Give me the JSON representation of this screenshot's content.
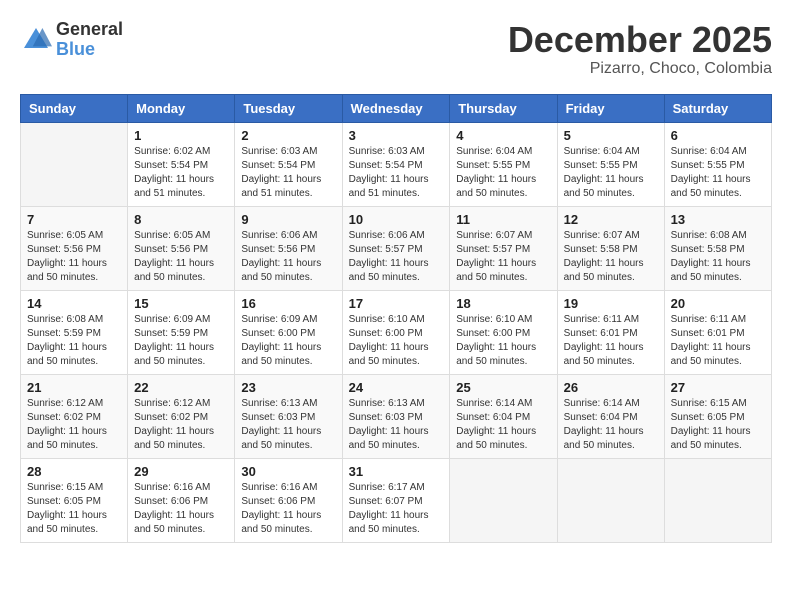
{
  "logo": {
    "general": "General",
    "blue": "Blue"
  },
  "title": "December 2025",
  "location": "Pizarro, Choco, Colombia",
  "days_of_week": [
    "Sunday",
    "Monday",
    "Tuesday",
    "Wednesday",
    "Thursday",
    "Friday",
    "Saturday"
  ],
  "weeks": [
    [
      {
        "day": "",
        "sunrise": "",
        "sunset": "",
        "daylight": ""
      },
      {
        "day": "1",
        "sunrise": "Sunrise: 6:02 AM",
        "sunset": "Sunset: 5:54 PM",
        "daylight": "Daylight: 11 hours and 51 minutes."
      },
      {
        "day": "2",
        "sunrise": "Sunrise: 6:03 AM",
        "sunset": "Sunset: 5:54 PM",
        "daylight": "Daylight: 11 hours and 51 minutes."
      },
      {
        "day": "3",
        "sunrise": "Sunrise: 6:03 AM",
        "sunset": "Sunset: 5:54 PM",
        "daylight": "Daylight: 11 hours and 51 minutes."
      },
      {
        "day": "4",
        "sunrise": "Sunrise: 6:04 AM",
        "sunset": "Sunset: 5:55 PM",
        "daylight": "Daylight: 11 hours and 50 minutes."
      },
      {
        "day": "5",
        "sunrise": "Sunrise: 6:04 AM",
        "sunset": "Sunset: 5:55 PM",
        "daylight": "Daylight: 11 hours and 50 minutes."
      },
      {
        "day": "6",
        "sunrise": "Sunrise: 6:04 AM",
        "sunset": "Sunset: 5:55 PM",
        "daylight": "Daylight: 11 hours and 50 minutes."
      }
    ],
    [
      {
        "day": "7",
        "sunrise": "Sunrise: 6:05 AM",
        "sunset": "Sunset: 5:56 PM",
        "daylight": "Daylight: 11 hours and 50 minutes."
      },
      {
        "day": "8",
        "sunrise": "Sunrise: 6:05 AM",
        "sunset": "Sunset: 5:56 PM",
        "daylight": "Daylight: 11 hours and 50 minutes."
      },
      {
        "day": "9",
        "sunrise": "Sunrise: 6:06 AM",
        "sunset": "Sunset: 5:56 PM",
        "daylight": "Daylight: 11 hours and 50 minutes."
      },
      {
        "day": "10",
        "sunrise": "Sunrise: 6:06 AM",
        "sunset": "Sunset: 5:57 PM",
        "daylight": "Daylight: 11 hours and 50 minutes."
      },
      {
        "day": "11",
        "sunrise": "Sunrise: 6:07 AM",
        "sunset": "Sunset: 5:57 PM",
        "daylight": "Daylight: 11 hours and 50 minutes."
      },
      {
        "day": "12",
        "sunrise": "Sunrise: 6:07 AM",
        "sunset": "Sunset: 5:58 PM",
        "daylight": "Daylight: 11 hours and 50 minutes."
      },
      {
        "day": "13",
        "sunrise": "Sunrise: 6:08 AM",
        "sunset": "Sunset: 5:58 PM",
        "daylight": "Daylight: 11 hours and 50 minutes."
      }
    ],
    [
      {
        "day": "14",
        "sunrise": "Sunrise: 6:08 AM",
        "sunset": "Sunset: 5:59 PM",
        "daylight": "Daylight: 11 hours and 50 minutes."
      },
      {
        "day": "15",
        "sunrise": "Sunrise: 6:09 AM",
        "sunset": "Sunset: 5:59 PM",
        "daylight": "Daylight: 11 hours and 50 minutes."
      },
      {
        "day": "16",
        "sunrise": "Sunrise: 6:09 AM",
        "sunset": "Sunset: 6:00 PM",
        "daylight": "Daylight: 11 hours and 50 minutes."
      },
      {
        "day": "17",
        "sunrise": "Sunrise: 6:10 AM",
        "sunset": "Sunset: 6:00 PM",
        "daylight": "Daylight: 11 hours and 50 minutes."
      },
      {
        "day": "18",
        "sunrise": "Sunrise: 6:10 AM",
        "sunset": "Sunset: 6:00 PM",
        "daylight": "Daylight: 11 hours and 50 minutes."
      },
      {
        "day": "19",
        "sunrise": "Sunrise: 6:11 AM",
        "sunset": "Sunset: 6:01 PM",
        "daylight": "Daylight: 11 hours and 50 minutes."
      },
      {
        "day": "20",
        "sunrise": "Sunrise: 6:11 AM",
        "sunset": "Sunset: 6:01 PM",
        "daylight": "Daylight: 11 hours and 50 minutes."
      }
    ],
    [
      {
        "day": "21",
        "sunrise": "Sunrise: 6:12 AM",
        "sunset": "Sunset: 6:02 PM",
        "daylight": "Daylight: 11 hours and 50 minutes."
      },
      {
        "day": "22",
        "sunrise": "Sunrise: 6:12 AM",
        "sunset": "Sunset: 6:02 PM",
        "daylight": "Daylight: 11 hours and 50 minutes."
      },
      {
        "day": "23",
        "sunrise": "Sunrise: 6:13 AM",
        "sunset": "Sunset: 6:03 PM",
        "daylight": "Daylight: 11 hours and 50 minutes."
      },
      {
        "day": "24",
        "sunrise": "Sunrise: 6:13 AM",
        "sunset": "Sunset: 6:03 PM",
        "daylight": "Daylight: 11 hours and 50 minutes."
      },
      {
        "day": "25",
        "sunrise": "Sunrise: 6:14 AM",
        "sunset": "Sunset: 6:04 PM",
        "daylight": "Daylight: 11 hours and 50 minutes."
      },
      {
        "day": "26",
        "sunrise": "Sunrise: 6:14 AM",
        "sunset": "Sunset: 6:04 PM",
        "daylight": "Daylight: 11 hours and 50 minutes."
      },
      {
        "day": "27",
        "sunrise": "Sunrise: 6:15 AM",
        "sunset": "Sunset: 6:05 PM",
        "daylight": "Daylight: 11 hours and 50 minutes."
      }
    ],
    [
      {
        "day": "28",
        "sunrise": "Sunrise: 6:15 AM",
        "sunset": "Sunset: 6:05 PM",
        "daylight": "Daylight: 11 hours and 50 minutes."
      },
      {
        "day": "29",
        "sunrise": "Sunrise: 6:16 AM",
        "sunset": "Sunset: 6:06 PM",
        "daylight": "Daylight: 11 hours and 50 minutes."
      },
      {
        "day": "30",
        "sunrise": "Sunrise: 6:16 AM",
        "sunset": "Sunset: 6:06 PM",
        "daylight": "Daylight: 11 hours and 50 minutes."
      },
      {
        "day": "31",
        "sunrise": "Sunrise: 6:17 AM",
        "sunset": "Sunset: 6:07 PM",
        "daylight": "Daylight: 11 hours and 50 minutes."
      },
      {
        "day": "",
        "sunrise": "",
        "sunset": "",
        "daylight": ""
      },
      {
        "day": "",
        "sunrise": "",
        "sunset": "",
        "daylight": ""
      },
      {
        "day": "",
        "sunrise": "",
        "sunset": "",
        "daylight": ""
      }
    ]
  ]
}
